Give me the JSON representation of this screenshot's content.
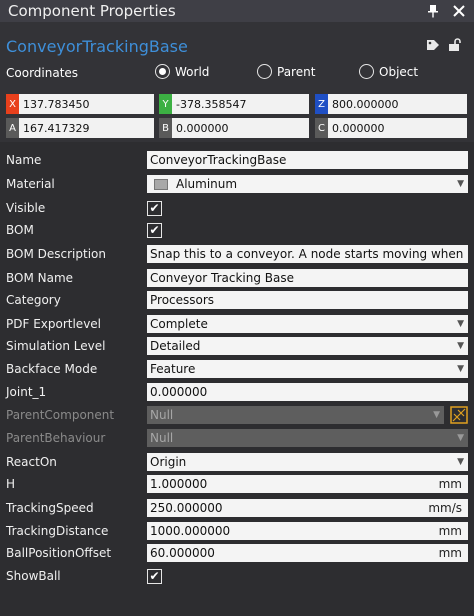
{
  "window": {
    "title": "Component Properties"
  },
  "component": {
    "name": "ConveyorTrackingBase"
  },
  "coordinates": {
    "label": "Coordinates",
    "options": [
      "World",
      "Parent",
      "Object"
    ],
    "selected": "World"
  },
  "position": {
    "x": {
      "tag": "X",
      "value": "137.783450",
      "color": "#e8401c"
    },
    "y": {
      "tag": "Y",
      "value": "-378.358547",
      "color": "#3cb043"
    },
    "z": {
      "tag": "Z",
      "value": "800.000000",
      "color": "#1f4fc4"
    }
  },
  "orientation": {
    "a": {
      "tag": "A",
      "value": "167.417329"
    },
    "b": {
      "tag": "B",
      "value": "0.000000"
    },
    "c": {
      "tag": "C",
      "value": "0.000000"
    }
  },
  "properties": {
    "name": {
      "label": "Name",
      "value": "ConveyorTrackingBase"
    },
    "material": {
      "label": "Material",
      "value": "Aluminum"
    },
    "visible": {
      "label": "Visible",
      "checked": true
    },
    "bom": {
      "label": "BOM",
      "checked": true
    },
    "bom_description": {
      "label": "BOM Description",
      "value": "Snap this to a conveyor. A node starts moving when produ"
    },
    "bom_name": {
      "label": "BOM Name",
      "value": "Conveyor Tracking Base"
    },
    "category": {
      "label": "Category",
      "value": "Processors"
    },
    "pdf_exportlevel": {
      "label": "PDF Exportlevel",
      "value": "Complete"
    },
    "simulation_level": {
      "label": "Simulation Level",
      "value": "Detailed"
    },
    "backface_mode": {
      "label": "Backface Mode",
      "value": "Feature"
    },
    "joint_1": {
      "label": "Joint_1",
      "value": "0.000000"
    },
    "parent_component": {
      "label": "ParentComponent",
      "value": "Null"
    },
    "parent_behaviour": {
      "label": "ParentBehaviour",
      "value": "Null"
    },
    "react_on": {
      "label": "ReactOn",
      "value": "Origin"
    },
    "h": {
      "label": "H",
      "value": "1.000000",
      "unit": "mm"
    },
    "tracking_speed": {
      "label": "TrackingSpeed",
      "value": "250.000000",
      "unit": "mm/s"
    },
    "tracking_distance": {
      "label": "TrackingDistance",
      "value": "1000.000000",
      "unit": "mm"
    },
    "ball_position_offset": {
      "label": "BallPositionOffset",
      "value": "60.000000",
      "unit": "mm"
    },
    "show_ball": {
      "label": "ShowBall",
      "checked": true
    }
  },
  "icons": [
    "pin-icon",
    "close-icon",
    "tag-icon",
    "unlock-icon",
    "pick-component-icon",
    "dropdown-arrow-icon",
    "checkmark-icon"
  ]
}
